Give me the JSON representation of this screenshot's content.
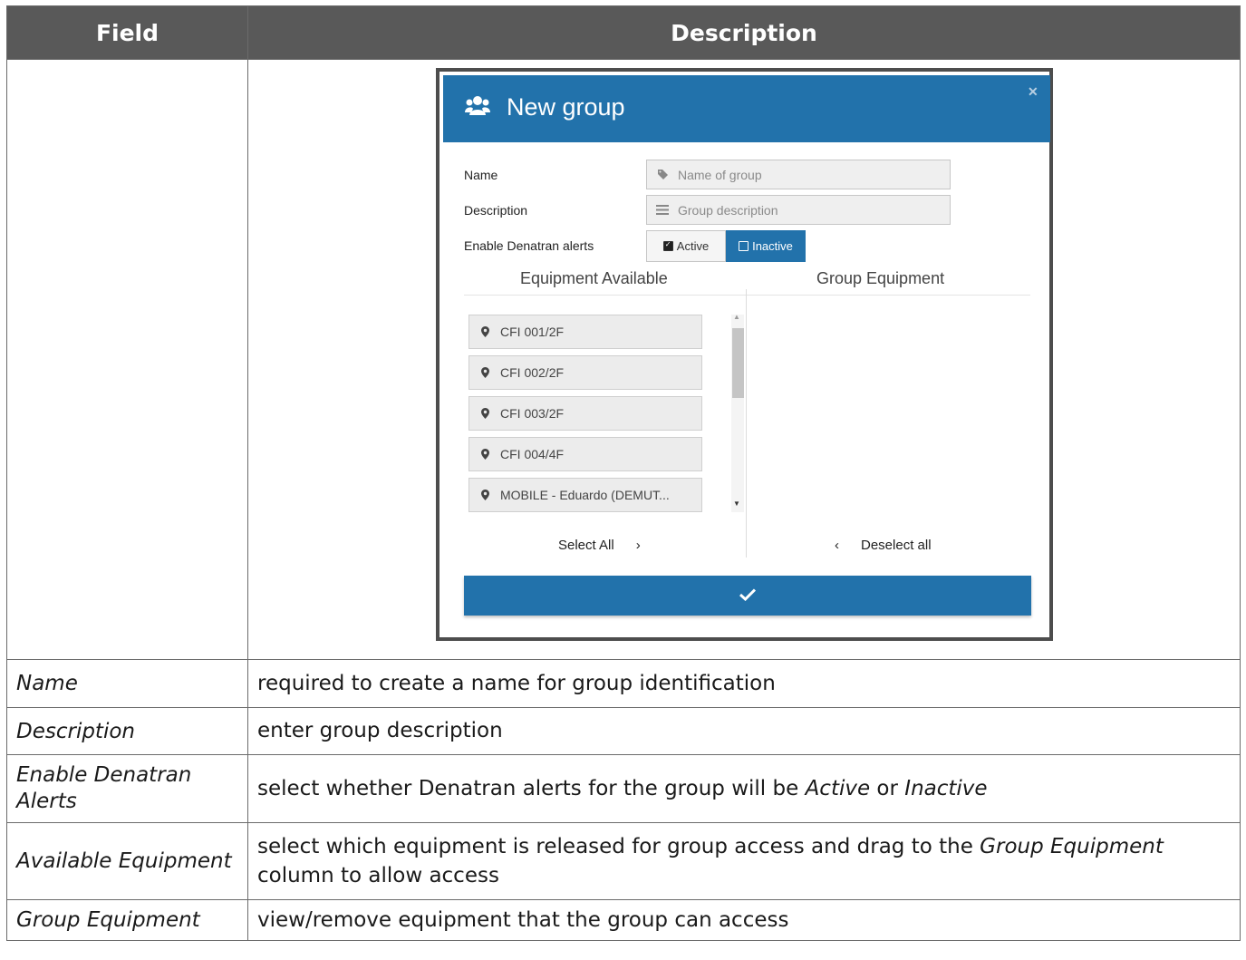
{
  "table": {
    "headers": [
      "Field",
      "Description"
    ],
    "rows": [
      {
        "field": "Name",
        "description": "required to create a name for group identification"
      },
      {
        "field": "Description",
        "description": "enter group description"
      },
      {
        "field": "Enable Denatran Alerts",
        "desc_pre": "select whether Denatran alerts for the group will be ",
        "desc_em1": "Active",
        "desc_mid": " or ",
        "desc_em2": "Inactive"
      },
      {
        "field": "Available Equipment",
        "desc_pre": "select which equipment is released for group access and drag to the ",
        "desc_em1": "Group Equipment",
        "desc_post": " column to allow access"
      },
      {
        "field": "Group Equipment",
        "description": "view/remove equipment that the group can access"
      }
    ]
  },
  "modal": {
    "title": "New group",
    "title_icon": "users-icon",
    "close_icon": "close-icon",
    "header_color": "#2272ab",
    "fields": {
      "name_label": "Name",
      "name_placeholder": "Name of group",
      "name_icon": "tag-icon",
      "description_label": "Description",
      "description_placeholder": "Group description",
      "description_icon": "lines-icon",
      "alerts_label": "Enable Denatran alerts",
      "alerts_options": [
        "Active",
        "Inactive"
      ],
      "alerts_selected": "Inactive"
    },
    "available": {
      "heading": "Equipment Available",
      "items": [
        "CFI 001/2F",
        "CFI 002/2F",
        "CFI 003/2F",
        "CFI 004/4F",
        "MOBILE - Eduardo (DEMUT..."
      ],
      "select_all": "Select All",
      "select_arrow": "›"
    },
    "group": {
      "heading": "Group Equipment",
      "items": [],
      "deselect_all": "Deselect all",
      "deselect_arrow": "‹"
    },
    "confirm_icon": "check-icon"
  }
}
